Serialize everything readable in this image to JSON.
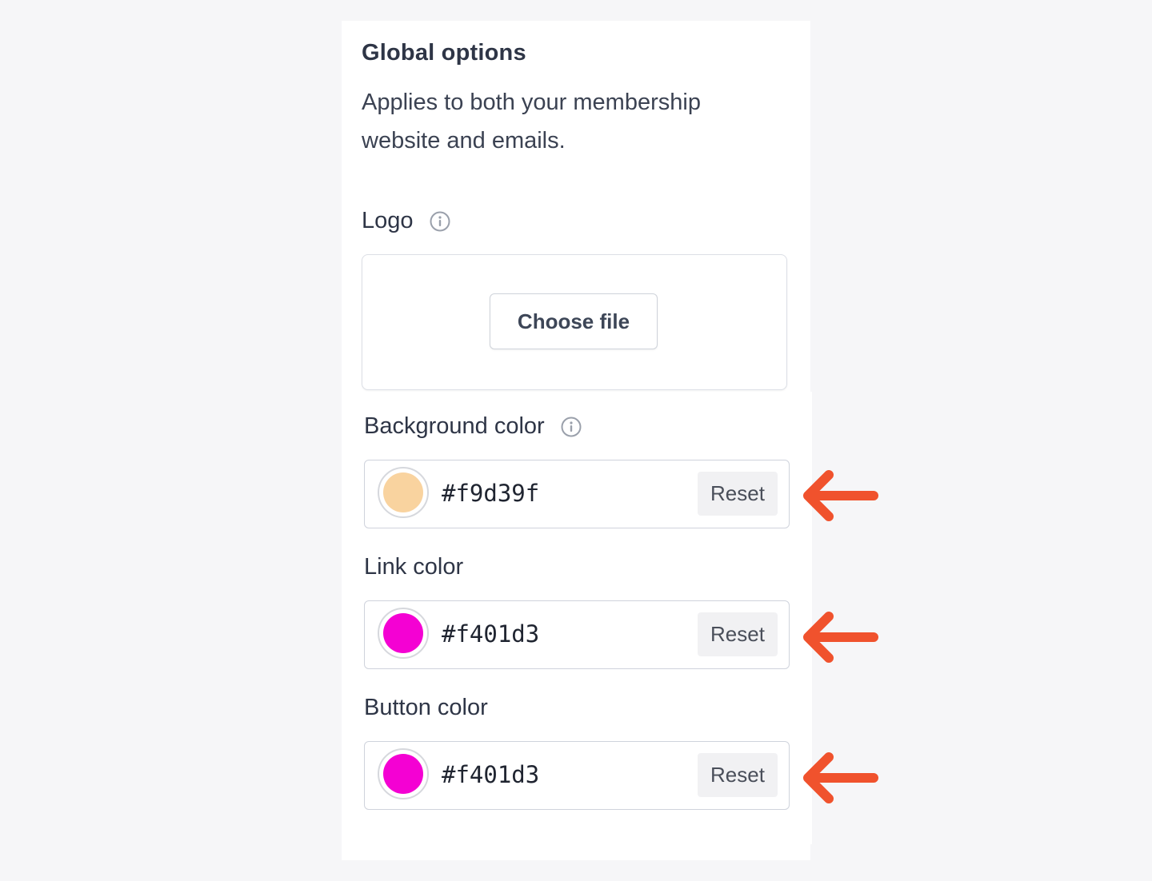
{
  "section": {
    "title": "Global options",
    "description": "Applies to both your membership website and emails."
  },
  "logo": {
    "label": "Logo",
    "info_icon": "info-icon",
    "choose_file_label": "Choose file"
  },
  "colors": [
    {
      "label": "Background color",
      "has_info": true,
      "value": "#f9d39f",
      "swatch": "#f9d39f",
      "reset_label": "Reset"
    },
    {
      "label": "Link color",
      "has_info": false,
      "value": "#f401d3",
      "swatch": "#f401d3",
      "reset_label": "Reset"
    },
    {
      "label": "Button color",
      "has_info": false,
      "value": "#f401d3",
      "swatch": "#f401d3",
      "reset_label": "Reset"
    }
  ],
  "annotation": {
    "arrow_color": "#f0522d",
    "arrow_icon": "arrow-left-icon"
  }
}
